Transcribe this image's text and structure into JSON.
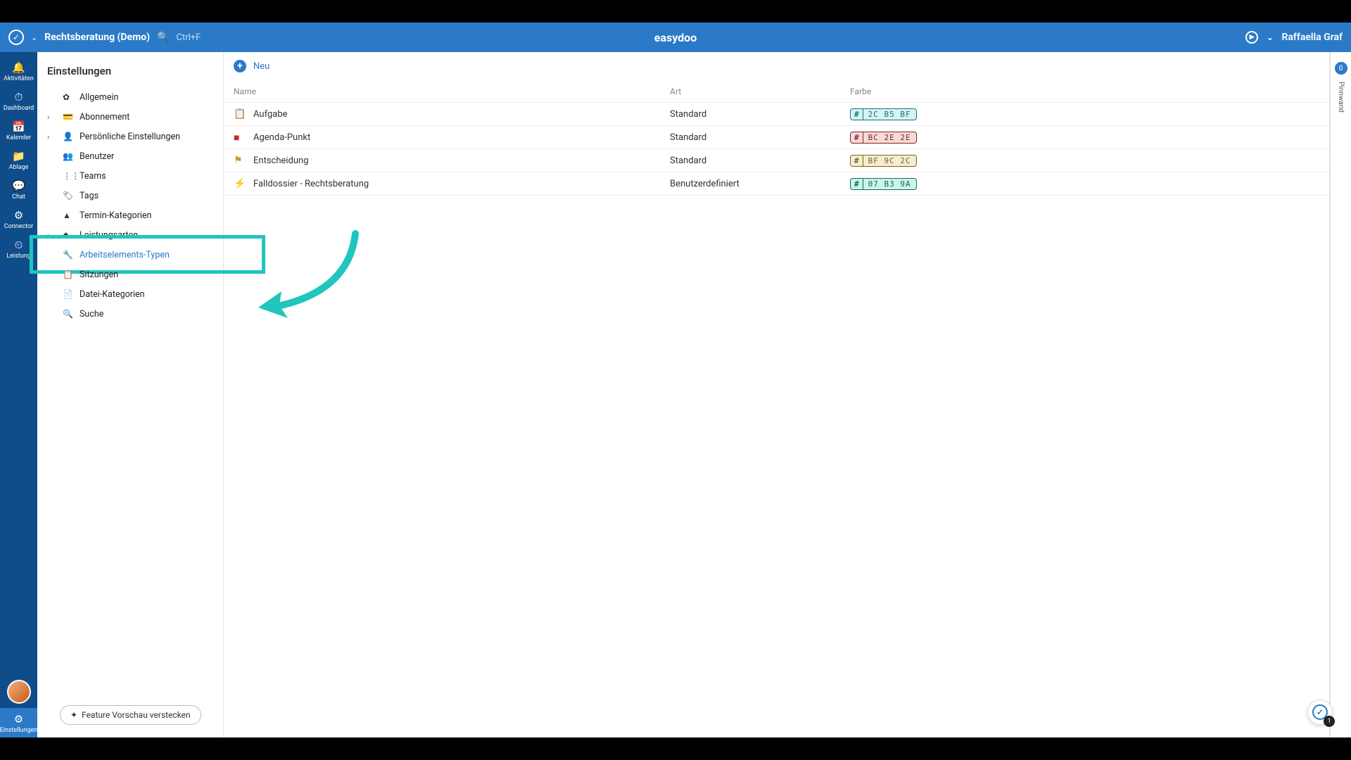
{
  "header": {
    "workspace": "Rechtsberatung (Demo)",
    "shortcut": "Ctrl+F",
    "app_name": "easydoo",
    "user_name": "Raffaella Graf"
  },
  "rail": {
    "items": [
      {
        "icon": "🔔",
        "label": "Aktivitäten"
      },
      {
        "icon": "⏱",
        "label": "Dashboard"
      },
      {
        "icon": "📅",
        "label": "Kalender"
      },
      {
        "icon": "📁",
        "label": "Ablage"
      },
      {
        "icon": "💬",
        "label": "Chat"
      },
      {
        "icon": "⚙",
        "label": "Connector"
      },
      {
        "icon": "⏲",
        "label": "Leistung"
      }
    ],
    "bottom": {
      "icon": "⚙",
      "label": "Einstellungen"
    }
  },
  "settings": {
    "title": "Einstellungen",
    "items": [
      {
        "icon": "✿",
        "label": "Allgemein",
        "exp": false
      },
      {
        "icon": "💳",
        "label": "Abonnement",
        "exp": true
      },
      {
        "icon": "👤",
        "label": "Persönliche Einstellungen",
        "exp": true
      },
      {
        "icon": "👥",
        "label": "Benutzer",
        "exp": false
      },
      {
        "icon": "⋮⋮",
        "label": "Teams",
        "exp": false
      },
      {
        "icon": "🏷",
        "label": "Tags",
        "exp": false
      },
      {
        "icon": "▲",
        "label": "Termin-Kategorien",
        "exp": false
      },
      {
        "icon": "◆",
        "label": "Leistungsarten",
        "exp": true
      },
      {
        "icon": "🔧",
        "label": "Arbeitselements-Typen",
        "exp": false,
        "selected": true
      },
      {
        "icon": "📋",
        "label": "Sitzungen",
        "exp": false
      },
      {
        "icon": "📄",
        "label": "Datei-Kategorien",
        "exp": false
      },
      {
        "icon": "🔍",
        "label": "Suche",
        "exp": false
      }
    ],
    "feature_btn": "Feature Vorschau verstecken"
  },
  "main": {
    "new_label": "Neu",
    "columns": {
      "name": "Name",
      "art": "Art",
      "farbe": "Farbe"
    },
    "rows": [
      {
        "icon": "📋",
        "icon_color": "#2CB5BF",
        "name": "Aufgabe",
        "art": "Standard",
        "hex": "2C B5 BF",
        "bg": "#d7f2f4",
        "fg": "#16747b"
      },
      {
        "icon": "■",
        "icon_color": "#BC2E2E",
        "name": "Agenda-Punkt",
        "art": "Standard",
        "hex": "BC 2E 2E",
        "bg": "#f6dada",
        "fg": "#8a1f1f"
      },
      {
        "icon": "⚑",
        "icon_color": "#BF9C2C",
        "name": "Entscheidung",
        "art": "Standard",
        "hex": "BF 9C 2C",
        "bg": "#f5ecd1",
        "fg": "#7a6316"
      },
      {
        "icon": "⚡",
        "icon_color": "#07B39A",
        "name": "Falldossier - Rechtsberatung",
        "art": "Benutzerdefiniert",
        "hex": "07 B3 9A",
        "bg": "#cff1eb",
        "fg": "#06715f"
      }
    ]
  },
  "pinnwand": {
    "badge": "0",
    "label": "Pinnwand"
  },
  "fab": {
    "count": "1"
  }
}
